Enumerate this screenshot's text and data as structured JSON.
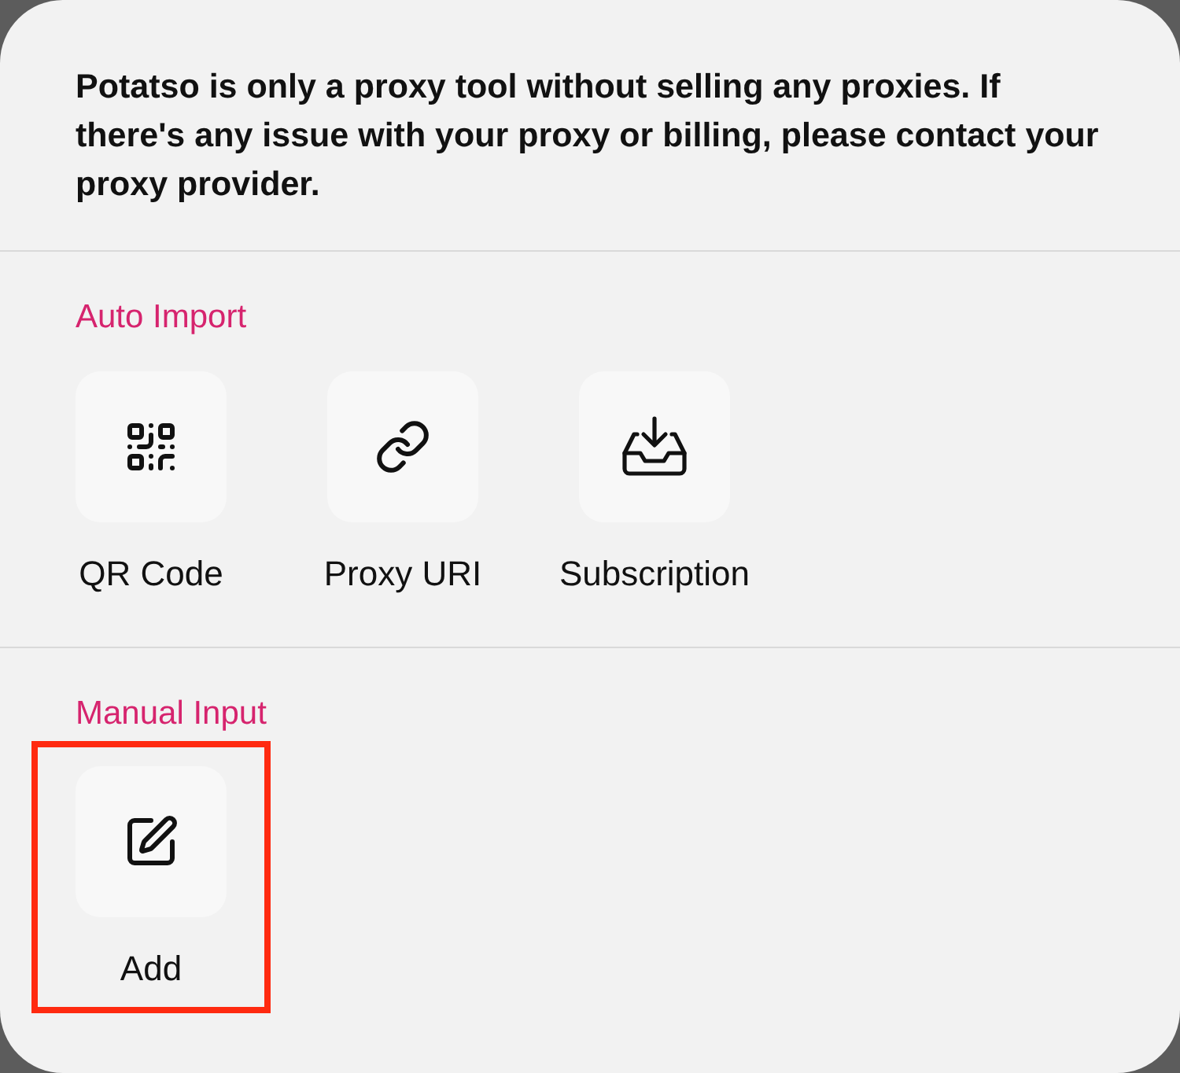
{
  "notice": "Potatso is only a proxy tool without selling any proxies. If there's any issue with your proxy or billing, please contact your proxy provider.",
  "sections": [
    {
      "title": "Auto Import",
      "items": [
        {
          "kind": "qr",
          "label": "QR Code",
          "highlighted": false
        },
        {
          "kind": "link",
          "label": "Proxy URI",
          "highlighted": false
        },
        {
          "kind": "inbox",
          "label": "Subscription",
          "highlighted": false
        }
      ]
    },
    {
      "title": "Manual Input",
      "items": [
        {
          "kind": "edit",
          "label": "Add",
          "highlighted": true
        }
      ]
    }
  ]
}
